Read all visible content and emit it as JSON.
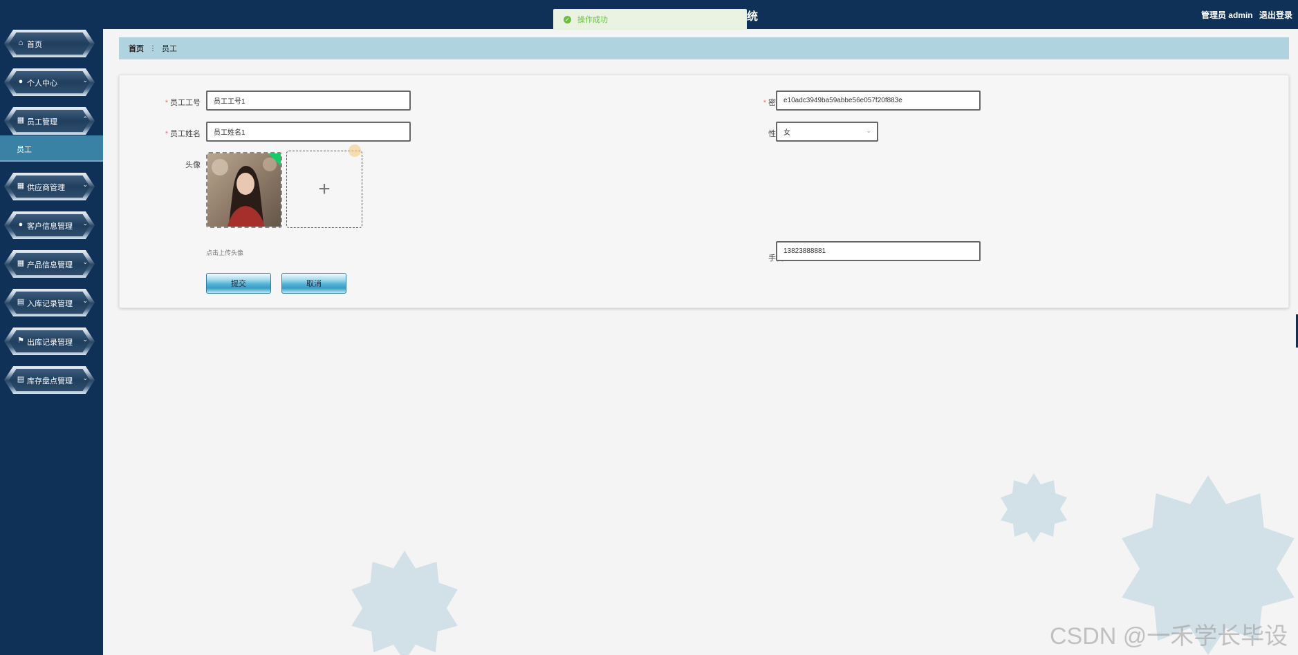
{
  "header": {
    "title_fragment": "统",
    "user_label": "管理员 admin",
    "logout_label": "退出登录"
  },
  "toast": {
    "message": "操作成功",
    "status_color": "#67c23a"
  },
  "sidebar": {
    "items": [
      {
        "label": "首页",
        "icon": "home-icon"
      },
      {
        "label": "个人中心",
        "icon": "user-icon"
      },
      {
        "label": "员工管理",
        "icon": "grid-icon",
        "expanded": true,
        "children": [
          {
            "label": "员工",
            "active": true
          }
        ]
      },
      {
        "label": "供应商管理",
        "icon": "grid-icon"
      },
      {
        "label": "客户信息管理",
        "icon": "user-icon"
      },
      {
        "label": "产品信息管理",
        "icon": "grid-icon"
      },
      {
        "label": "入库记录管理",
        "icon": "clipboard-icon"
      },
      {
        "label": "出库记录管理",
        "icon": "flag-icon"
      },
      {
        "label": "库存盘点管理",
        "icon": "clipboard-icon"
      }
    ]
  },
  "breadcrumb": {
    "home": "首页",
    "current": "员工"
  },
  "form": {
    "employee_id": {
      "label": "员工工号",
      "value": "员工工号1",
      "required": true
    },
    "password": {
      "label": "密码",
      "value": "e10adc3949ba59abbe56e057f20f883e",
      "required": true
    },
    "employee_name": {
      "label": "员工姓名",
      "value": "员工姓名1",
      "required": true
    },
    "gender": {
      "label": "性别",
      "value": "女"
    },
    "avatar": {
      "label": "头像",
      "hint": "点击上传头像"
    },
    "phone": {
      "label": "手机",
      "value": "13823888881"
    },
    "submit_label": "提交",
    "cancel_label": "取消"
  },
  "watermark": "CSDN @一禾学长毕设",
  "colors": {
    "sidebar": "#0f3158",
    "breadcrumb": "#b0d4df",
    "required": "#f56c6c",
    "star": "#d2e0e8"
  }
}
